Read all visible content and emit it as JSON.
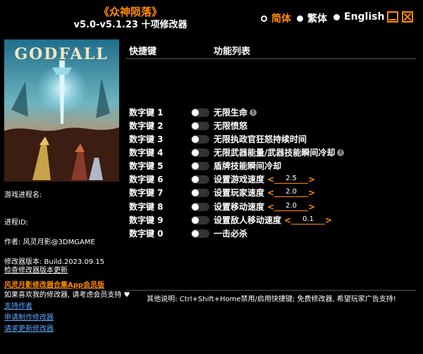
{
  "header": {
    "game_title": "《众神陨落》",
    "version_line": "v5.0-v5.1.23 十项修改器"
  },
  "languages": [
    "简体",
    "繁体",
    "English"
  ],
  "cover": {
    "logo_text": "GODFALL"
  },
  "columns": {
    "hotkey": "快捷键",
    "function": "功能列表"
  },
  "rows": [
    {
      "key": "数字键 1",
      "label": "无限生命",
      "info": true
    },
    {
      "key": "数字键 2",
      "label": "无限愤怒"
    },
    {
      "key": "数字键 3",
      "label": "无限执政官狂怒持续时间"
    },
    {
      "key": "数字键 4",
      "label": "无限武器能量/武器技能瞬间冷却",
      "info": true
    },
    {
      "key": "数字键 5",
      "label": "盾牌技能瞬间冷却"
    },
    {
      "key": "数字键 6",
      "label": "设置游戏速度",
      "value": "2.5"
    },
    {
      "key": "数字键 7",
      "label": "设置玩家速度",
      "value": "2.0"
    },
    {
      "key": "数字键 8",
      "label": "设置移动速度",
      "value": "2.0"
    },
    {
      "key": "数字键 9",
      "label": "设置敌人移动速度",
      "value": "0.1"
    },
    {
      "key": "数字键 0",
      "label": "一击必杀"
    }
  ],
  "sidebar": {
    "process_name_label": "游戏进程名:",
    "process_id_label": "进程ID:",
    "author": "作者: 风灵月影@3DMGAME",
    "build": "修改器版本: Build.2023.09.15",
    "check_update": "检查修改器版本更新",
    "vip_link": "风灵月影修改器合集App会员版",
    "support_text": "如果喜欢我的修改器, 请考虑会员支持",
    "support_author": "支持作者",
    "request_trainer": "申请制作修改器",
    "request_update": "请求更新修改器"
  },
  "footer": {
    "note": "其他说明: Ctrl+Shift+Home禁用/启用快捷键; 免费修改器, 希望玩家广告支持!"
  },
  "colors": {
    "accent": "#ff8c00",
    "background": "#000000",
    "link": "#5aa9ff"
  }
}
